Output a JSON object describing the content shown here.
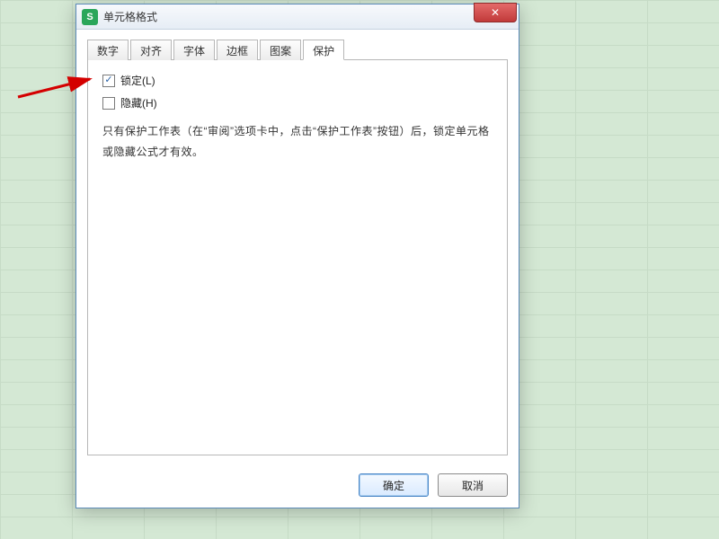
{
  "app_icon_letter": "S",
  "title": "单元格格式",
  "close_glyph": "✕",
  "tabs": {
    "t0": "数字",
    "t1": "对齐",
    "t2": "字体",
    "t3": "边框",
    "t4": "图案",
    "t5": "保护"
  },
  "protect": {
    "lock_label": "锁定(L)",
    "hide_label": "隐藏(H)",
    "lock_checked": true,
    "hide_checked": false,
    "description": "只有保护工作表（在“审阅”选项卡中，点击“保护工作表”按钮）后，锁定单元格或隐藏公式才有效。"
  },
  "buttons": {
    "ok": "确定",
    "cancel": "取消"
  }
}
